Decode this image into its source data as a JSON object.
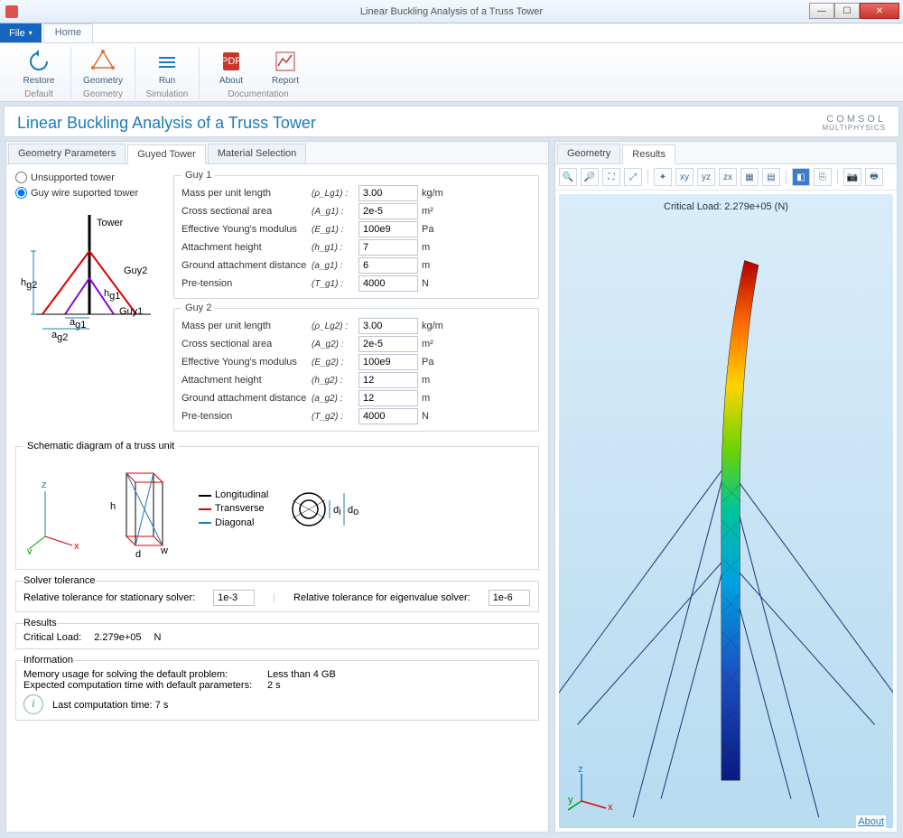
{
  "window": {
    "title": "Linear Buckling Analysis of a Truss Tower"
  },
  "menu": {
    "file": "File",
    "home": "Home"
  },
  "ribbon": {
    "restore": "Restore",
    "geometry": "Geometry",
    "run": "Run",
    "about": "About",
    "report": "Report",
    "g_default": "Default",
    "g_geometry": "Geometry",
    "g_simulation": "Simulation",
    "g_doc": "Documentation"
  },
  "title": "Linear Buckling Analysis of a  Truss Tower",
  "logo": {
    "l1": "COMSOL",
    "l2": "MULTIPHYSICS"
  },
  "ltabs": {
    "t1": "Geometry Parameters",
    "t2": "Guyed Tower",
    "t3": "Material Selection"
  },
  "radios": {
    "unsupported": "Unsupported tower",
    "guyed": "Guy wire suported tower"
  },
  "diagram_labels": {
    "tower": "Tower",
    "guy1": "Guy1",
    "guy2": "Guy2",
    "hg2": "h",
    "hg1": "h",
    "ag1": "a",
    "ag2": "a"
  },
  "guy1": {
    "legend": "Guy 1",
    "mass_l": "Mass per unit length",
    "mass_s": "(ρ_Lg1) :",
    "mass_v": "3.00",
    "mass_u": "kg/m",
    "area_l": "Cross sectional area",
    "area_s": "(A_g1) :",
    "area_v": "2e-5",
    "area_u": "m²",
    "ym_l": "Effective Young's modulus",
    "ym_s": "(E_g1) :",
    "ym_v": "100e9",
    "ym_u": "Pa",
    "ah_l": "Attachment height",
    "ah_s": "(h_g1) :",
    "ah_v": "7",
    "ah_u": "m",
    "gd_l": "Ground attachment distance",
    "gd_s": "(a_g1) :",
    "gd_v": "6",
    "gd_u": "m",
    "pt_l": "Pre-tension",
    "pt_s": "(T_g1) :",
    "pt_v": "4000",
    "pt_u": "N"
  },
  "guy2": {
    "legend": "Guy 2",
    "mass_l": "Mass per unit length",
    "mass_s": "(ρ_Lg2) :",
    "mass_v": "3.00",
    "mass_u": "kg/m",
    "area_l": "Cross sectional area",
    "area_s": "(A_g2) :",
    "area_v": "2e-5",
    "area_u": "m²",
    "ym_l": "Effective Young's modulus",
    "ym_s": "(E_g2) :",
    "ym_v": "100e9",
    "ym_u": "Pa",
    "ah_l": "Attachment height",
    "ah_s": "(h_g2) :",
    "ah_v": "12",
    "ah_u": "m",
    "gd_l": "Ground attachment distance",
    "gd_s": "(a_g2) :",
    "gd_v": "12",
    "gd_u": "m",
    "pt_l": "Pre-tension",
    "pt_s": "(T_g2) :",
    "pt_v": "4000",
    "pt_u": "N"
  },
  "schematic": {
    "legend": "Schematic diagram of a truss unit",
    "l_long": "Longitudinal",
    "l_trans": "Transverse",
    "l_diag": "Diagonal",
    "h": "h",
    "d": "d",
    "w": "w",
    "di": "d_i",
    "do": "d_o",
    "axes": {
      "x": "x",
      "y": "y",
      "z": "z"
    }
  },
  "solver": {
    "legend": "Solver tolerance",
    "stat_l": "Relative tolerance for stationary solver:",
    "stat_v": "1e-3",
    "eig_l": "Relative tolerance for eigenvalue solver:",
    "eig_v": "1e-6"
  },
  "results": {
    "legend": "Results",
    "cl_l": "Critical Load:",
    "cl_v": "2.279e+05",
    "cl_u": "N"
  },
  "info": {
    "legend": "Information",
    "mem_l": "Memory usage for solving the default problem:",
    "mem_v": "Less than 4 GB",
    "time_l": "Expected computation time with default parameters:",
    "time_v": "2 s",
    "last": "Last computation time: 7 s"
  },
  "rtabs": {
    "t1": "Geometry",
    "t2": "Results"
  },
  "viewport": {
    "crit": "Critical Load: 2.279e+05 (N)"
  },
  "about": "About"
}
